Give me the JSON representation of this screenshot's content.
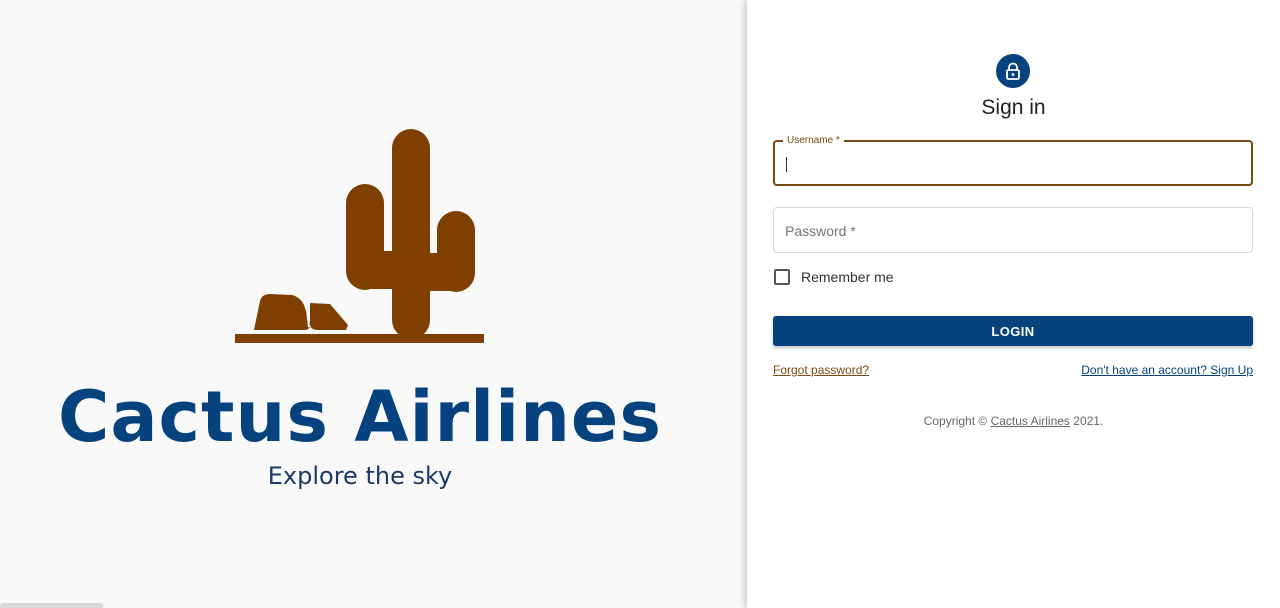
{
  "brand": {
    "name": "Cactus Airlines",
    "tagline": "Explore the sky",
    "logo_icon": "cactus-logo-icon",
    "colors": {
      "primary": "#05427e",
      "accent": "#7a4a12",
      "logo": "#7f3f00"
    }
  },
  "form": {
    "title": "Sign in",
    "avatar_icon": "lock-icon",
    "username_label": "Username *",
    "username_value": "",
    "password_label": "Password *",
    "password_value": "",
    "remember_label": "Remember me",
    "remember_checked": false,
    "login_label": "LOGIN",
    "forgot_label": "Forgot password?",
    "signup_label": "Don't have an account? Sign Up"
  },
  "footer": {
    "prefix": "Copyright © ",
    "link": "Cactus Airlines",
    "suffix": " 2021."
  }
}
